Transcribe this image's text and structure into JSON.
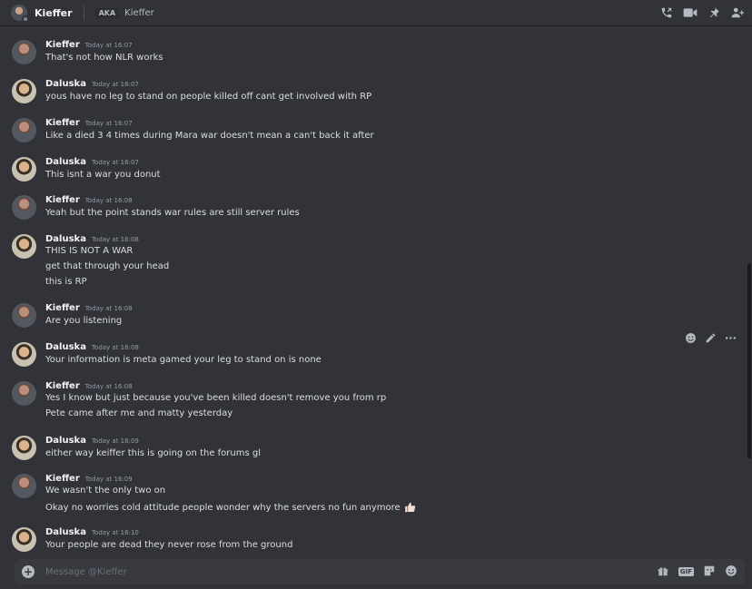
{
  "header": {
    "dm_name": "Kieffer",
    "aka_badge": "AKA",
    "aka_name": "Kieffer"
  },
  "messages": [
    {
      "author": "Kieffer",
      "time": "Today at 16:07",
      "lines": [
        "That's not how NLR works"
      ]
    },
    {
      "author": "Daluska",
      "time": "Today at 16:07",
      "lines": [
        "yous have no leg to stand on people killed off cant get involved with RP"
      ]
    },
    {
      "author": "Kieffer",
      "time": "Today at 16:07",
      "lines": [
        "Like a died 3 4 times during Mara war doesn't mean a can't back it after"
      ]
    },
    {
      "author": "Daluska",
      "time": "Today at 16:07",
      "lines": [
        "This isnt a war you donut"
      ]
    },
    {
      "author": "Kieffer",
      "time": "Today at 16:08",
      "lines": [
        "Yeah but the point stands war rules are still server rules"
      ]
    },
    {
      "author": "Daluska",
      "time": "Today at 16:08",
      "lines": [
        "THIS IS NOT A WAR",
        "get that through your head",
        "this is RP"
      ]
    },
    {
      "author": "Kieffer",
      "time": "Today at 16:08",
      "lines": [
        "Are you listening"
      ]
    },
    {
      "author": "Daluska",
      "time": "Today at 16:08",
      "lines": [
        "Your information is meta gamed your leg to stand on is none"
      ]
    },
    {
      "author": "Kieffer",
      "time": "Today at 16:08",
      "lines": [
        "Yes I know but just because you've been killed doesn't remove you from rp",
        "Pete came after me and matty yesterday"
      ]
    },
    {
      "author": "Daluska",
      "time": "Today at 16:09",
      "lines": [
        "either way keiffer this is going on the forums gl"
      ]
    },
    {
      "author": "Kieffer",
      "time": "Today at 16:09",
      "lines": [
        "We wasn't the only two on",
        "Okay no worries cold attitude people wonder why the servers no fun anymore"
      ]
    },
    {
      "author": "Daluska",
      "time": "Today at 16:10",
      "lines": [
        "Your people are dead they never rose from the ground"
      ]
    }
  ],
  "composer": {
    "placeholder": "Message @Kieffer",
    "gif_label": "GIF"
  },
  "icons": {
    "header": [
      "phone-call-icon",
      "video-call-icon",
      "pin-icon",
      "add-friend-icon"
    ],
    "hover": [
      "add-reaction-icon",
      "edit-icon",
      "more-icon"
    ],
    "composer": [
      "plus-icon",
      "gift-icon",
      "gif-icon",
      "sticker-icon",
      "emoji-icon"
    ]
  },
  "colors": {
    "background": "#313338",
    "composer": "#383a40",
    "text": "#dbdee1",
    "username": "#f2f3f5",
    "timestamp": "#949ba4"
  }
}
